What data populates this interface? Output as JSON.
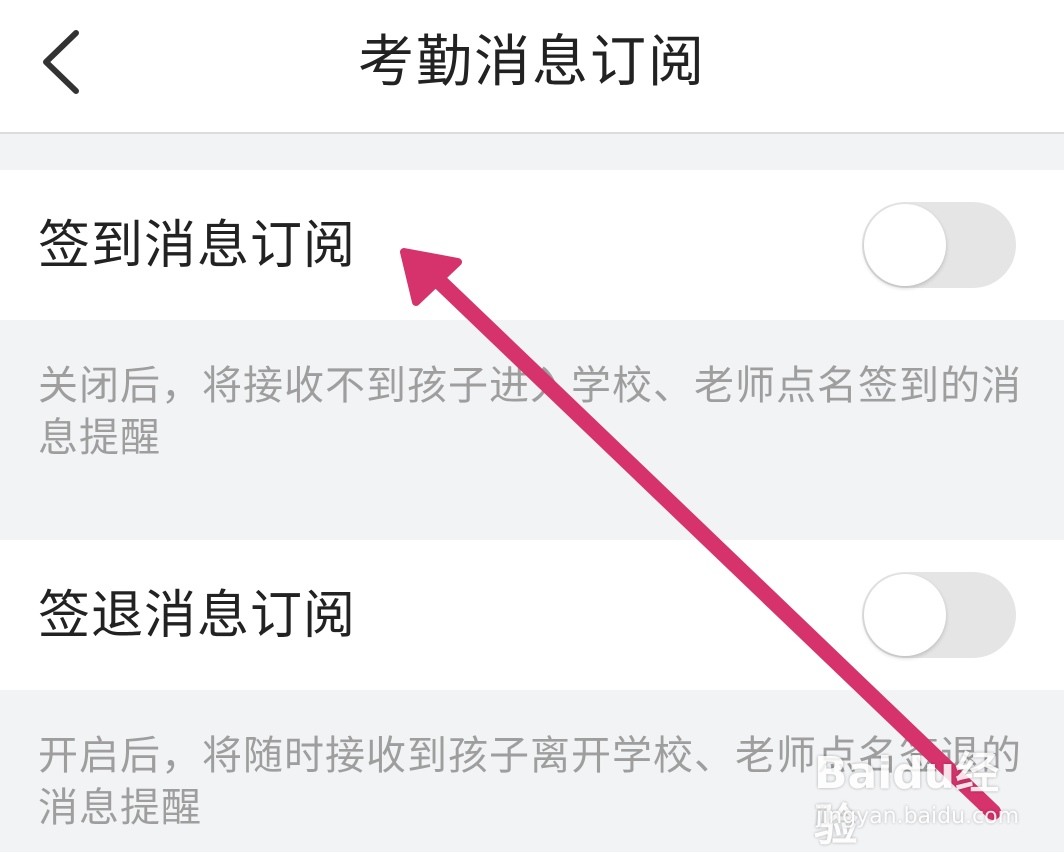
{
  "header": {
    "title": "考勤消息订阅",
    "back_icon": "chevron-left-icon"
  },
  "settings": [
    {
      "label": "签到消息订阅",
      "enabled": false,
      "description": "关闭后，将接收不到孩子进入学校、老师点名签到的消息提醒"
    },
    {
      "label": "签退消息订阅",
      "enabled": false,
      "description": "开启后，将随时接收到孩子离开学校、老师点名签退的消息提醒"
    }
  ],
  "annotation": {
    "arrow_color": "#d6336c"
  },
  "watermark": {
    "brand": "Baidu经验",
    "url": "jingyan.baidu.com"
  },
  "colors": {
    "background": "#f2f3f5",
    "toggle_off": "#e5e5e5",
    "description_text": "#9e9e9e"
  }
}
